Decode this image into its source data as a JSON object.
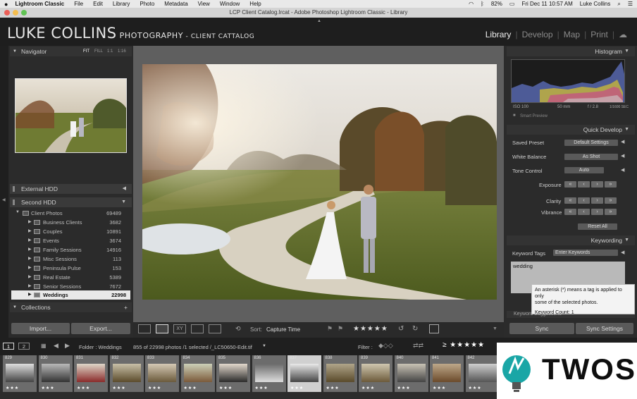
{
  "menubar": {
    "apple": "",
    "items": [
      "Lightroom Classic",
      "File",
      "Edit",
      "Library",
      "Photo",
      "Metadata",
      "View",
      "Window",
      "Help"
    ],
    "battery": "82%",
    "datetime": "Fri Dec 11  10:57 AM",
    "user": "Luke Collins"
  },
  "window": {
    "title": "LCP Client Catalog.lrcat - Adobe Photoshop Lightroom Classic - Library"
  },
  "identity": {
    "plate_big": "LUKE COLLINS",
    "plate_rest": " PHOTOGRAPHY",
    "plate_sub": " - CLIENT CATTALOG"
  },
  "modules": [
    "Library",
    "Develop",
    "Map",
    "Print"
  ],
  "navigator": {
    "title": "Navigator",
    "zoom_options": [
      "FIT",
      "FILL",
      "1:1",
      "1:16"
    ]
  },
  "volumes": [
    {
      "label": "External HDD"
    },
    {
      "label": "Second HDD"
    }
  ],
  "folders": {
    "root": {
      "name": "Client Photos",
      "count": "69489"
    },
    "items": [
      {
        "name": "Business Clients",
        "count": "3682"
      },
      {
        "name": "Couples",
        "count": "10891"
      },
      {
        "name": "Events",
        "count": "3674"
      },
      {
        "name": "Family Sessions",
        "count": "14916"
      },
      {
        "name": "Misc Sessions",
        "count": "113"
      },
      {
        "name": "Peninsula Pulse",
        "count": "153"
      },
      {
        "name": "Real Estate",
        "count": "5389"
      },
      {
        "name": "Senior Sessions",
        "count": "7672"
      },
      {
        "name": "Weddings",
        "count": "22998"
      }
    ]
  },
  "collections": {
    "title": "Collections",
    "add": "+"
  },
  "left_buttons": {
    "import": "Import...",
    "export": "Export..."
  },
  "toolbar": {
    "sort_label": "Sort:",
    "sort_value": "Capture Time",
    "rating": "★★★★★"
  },
  "histogram": {
    "title": "Histogram",
    "iso": "ISO 100",
    "focal": "50 mm",
    "aperture": "f / 2.8",
    "shutter": "1/1600 SEC",
    "smart_preview": "Smart Preview"
  },
  "quick_develop": {
    "title": "Quick Develop",
    "saved_preset_label": "Saved Preset",
    "saved_preset_value": "Default Settings",
    "white_balance_label": "White Balance",
    "white_balance_value": "As Shot",
    "tone_control_label": "Tone Control",
    "auto_label": "Auto",
    "exposure_label": "Exposure",
    "clarity_label": "Clarity",
    "vibrance_label": "Vibrance",
    "reset_label": "Reset All"
  },
  "keywording": {
    "title": "Keywording",
    "tags_label": "Keyword Tags",
    "tags_select": "Enter Keywords",
    "text": "wedding",
    "suggestions_label": "Keyword Suggestions"
  },
  "tooltip": {
    "line1": "An asterisk (*) means a tag is applied to only",
    "line2": "some of the selected photos.",
    "line3": "Keyword Count: 1"
  },
  "sync": {
    "sync": "Sync",
    "sync_settings": "Sync Settings"
  },
  "filmbar": {
    "page1": "1",
    "page2": "2",
    "folder": "Folder : Weddings",
    "count_info": "855 of 22998 photos /1 selected /_LC50650-Edit.tif",
    "filter_label": "Filter :",
    "rating": "≥ ★★★★★"
  },
  "thumbs": [
    {
      "num": "829",
      "stars": "★★★"
    },
    {
      "num": "830",
      "stars": "★★★"
    },
    {
      "num": "831",
      "stars": "★★★"
    },
    {
      "num": "832",
      "stars": "★★★"
    },
    {
      "num": "833",
      "stars": "★★★"
    },
    {
      "num": "834",
      "stars": "★★★"
    },
    {
      "num": "835",
      "stars": "★★★"
    },
    {
      "num": "836",
      "stars": "★★★"
    },
    {
      "num": "837",
      "stars": "★★★"
    },
    {
      "num": "838",
      "stars": "★★★"
    },
    {
      "num": "839",
      "stars": "★★★"
    },
    {
      "num": "840",
      "stars": "★★★"
    },
    {
      "num": "841",
      "stars": "★★★"
    },
    {
      "num": "842",
      "stars": "★★★"
    }
  ],
  "logo": {
    "text": "TWOS"
  }
}
